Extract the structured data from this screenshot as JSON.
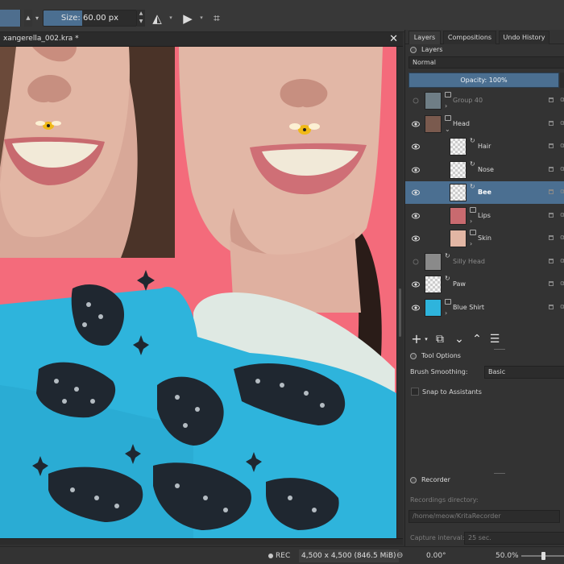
{
  "toolbar": {
    "size_label": "Size:",
    "size_value": "60.00 px",
    "size_fill_fraction": 0.42
  },
  "document": {
    "tab_title": "xangerella_002.kra *",
    "close_glyph": "✕"
  },
  "docker": {
    "tabs": [
      "Layers",
      "Compositions",
      "Undo History"
    ],
    "layers_title": "Layers",
    "blend_mode": "Normal",
    "opacity_label": "Opacity:  100%",
    "layers": [
      {
        "name": "Group 40",
        "visible": false,
        "indent": 0,
        "group": true
      },
      {
        "name": "Head",
        "visible": true,
        "indent": 0,
        "group": true
      },
      {
        "name": "Hair",
        "visible": true,
        "indent": 1,
        "group": false
      },
      {
        "name": "Nose",
        "visible": true,
        "indent": 1,
        "group": false
      },
      {
        "name": "Bee",
        "visible": true,
        "indent": 1,
        "group": false,
        "selected": true
      },
      {
        "name": "Lips",
        "visible": true,
        "indent": 1,
        "group": true
      },
      {
        "name": "Skin",
        "visible": true,
        "indent": 1,
        "group": true
      },
      {
        "name": "Silly Head",
        "visible": false,
        "indent": 0,
        "group": false
      },
      {
        "name": "Paw",
        "visible": true,
        "indent": 0,
        "group": false
      },
      {
        "name": "Blue Shirt",
        "visible": true,
        "indent": 0,
        "group": true
      }
    ],
    "alpha_glyph": "α",
    "tool_options_title": "Tool Options",
    "brush_smoothing_label": "Brush Smoothing:",
    "brush_smoothing_value": "Basic",
    "snap_label": "Snap to Assistants",
    "recorder_title": "Recorder",
    "recordings_dir_label": "Recordings directory:",
    "recordings_dir_value": "/home/meow/KritaRecorder",
    "capture_interval_label": "Capture interval:",
    "capture_interval_value": "25 sec."
  },
  "status": {
    "rec_label": "REC",
    "dimensions": "4,500 x 4,500 (846.5 MiB)",
    "rotation": "0.00°",
    "zoom": "50.0%"
  },
  "colors": {
    "accent": "#4b6f91",
    "background": "#f46b7b",
    "sweater": "#2eb4dc"
  }
}
